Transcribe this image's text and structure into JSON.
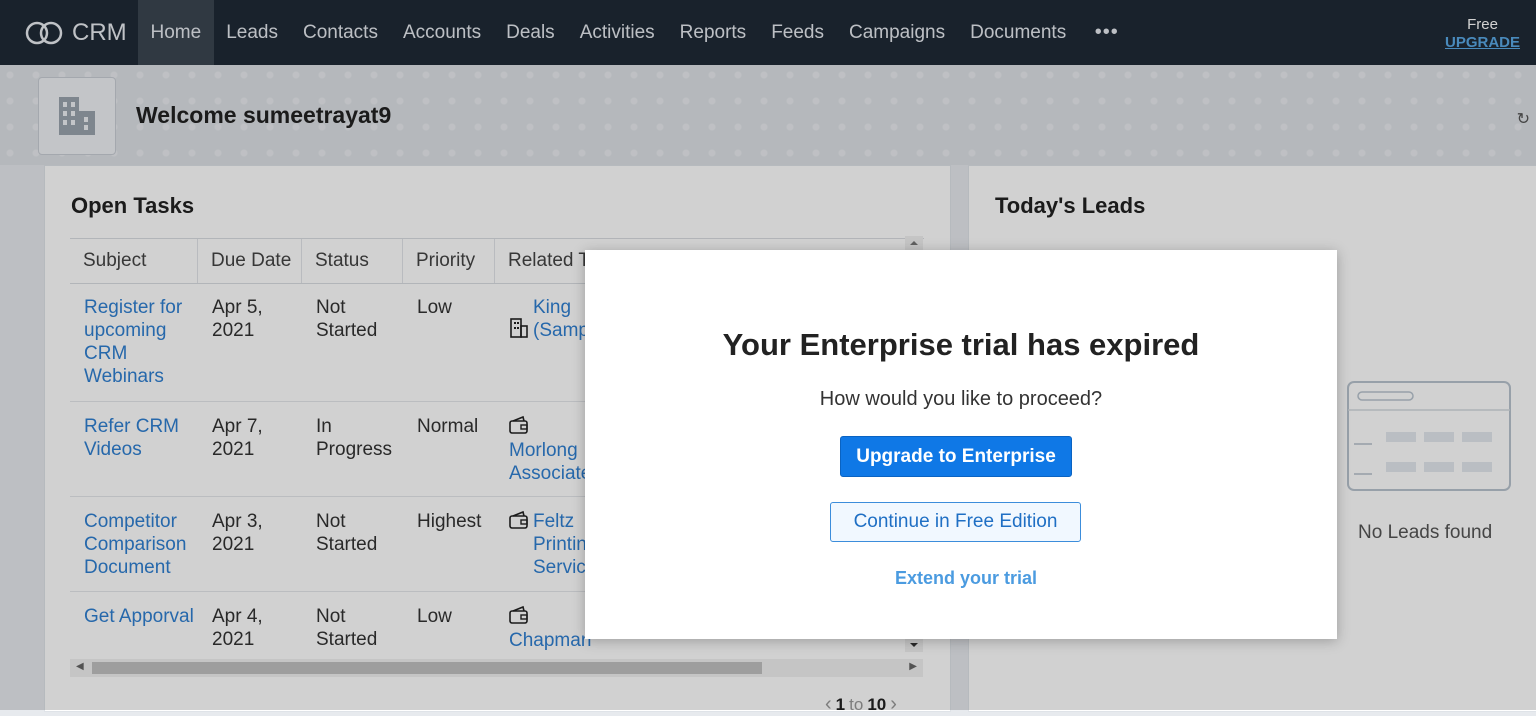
{
  "nav": {
    "logo_text": "CRM",
    "items": [
      "Home",
      "Leads",
      "Contacts",
      "Accounts",
      "Deals",
      "Activities",
      "Reports",
      "Feeds",
      "Campaigns",
      "Documents"
    ],
    "active": "Home",
    "more": "•••",
    "plan_label": "Free",
    "upgrade_label": "UPGRADE"
  },
  "banner": {
    "welcome": "Welcome sumeetrayat9"
  },
  "open_tasks": {
    "title": "Open Tasks",
    "columns": [
      "Subject",
      "Due Date",
      "Status",
      "Priority",
      "Related To"
    ],
    "rows": [
      {
        "subject": "Register for upcoming CRM Webinars",
        "due": "Apr 5, 2021",
        "status": "Not Started",
        "priority": "Low",
        "related": "King (Sample)",
        "related_icon": "building-icon"
      },
      {
        "subject": "Refer CRM Videos",
        "due": "Apr 7, 2021",
        "status": "In Progress",
        "priority": "Normal",
        "related": "Morlong Associates",
        "related_icon": "wallet-icon"
      },
      {
        "subject": "Competitor Comparison Document",
        "due": "Apr 3, 2021",
        "status": "Not Started",
        "priority": "Highest",
        "related": "Feltz Printing Service",
        "related_icon": "wallet-icon"
      },
      {
        "subject": "Get Apporval",
        "due": "Apr 4, 2021",
        "status": "Not Started",
        "priority": "Low",
        "related": "Chapman",
        "related_icon": "wallet-icon"
      }
    ],
    "pager": {
      "from": "1",
      "to_word": "to",
      "to": "10"
    }
  },
  "todays_leads": {
    "title": "Today's Leads",
    "empty_text": "No Leads found"
  },
  "modal": {
    "title": "Your Enterprise trial has expired",
    "subtitle": "How would you like to proceed?",
    "primary_button": "Upgrade to Enterprise",
    "secondary_button": "Continue in Free Edition",
    "link": "Extend your trial"
  },
  "colors": {
    "nav_bg": "#1f2a36",
    "link": "#2f7fd1",
    "primary": "#0f78e6"
  }
}
